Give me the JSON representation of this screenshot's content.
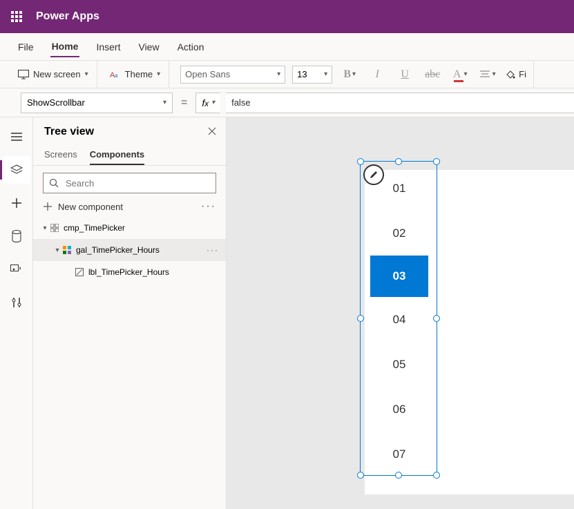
{
  "header": {
    "app_name": "Power Apps"
  },
  "menu": {
    "file": "File",
    "home": "Home",
    "insert": "Insert",
    "view": "View",
    "action": "Action"
  },
  "toolbar": {
    "new_screen": "New screen",
    "theme": "Theme",
    "font": "Open Sans",
    "font_size": "13",
    "format_fill_label": "Fi"
  },
  "formula": {
    "property": "ShowScrollbar",
    "value": "false"
  },
  "tree": {
    "title": "Tree view",
    "tabs": {
      "screens": "Screens",
      "components": "Components"
    },
    "search_placeholder": "Search",
    "new_component": "New component",
    "items": [
      {
        "name": "cmp_TimePicker"
      },
      {
        "name": "gal_TimePicker_Hours"
      },
      {
        "name": "lbl_TimePicker_Hours"
      }
    ]
  },
  "canvas": {
    "hours": [
      "01",
      "02",
      "03",
      "04",
      "05",
      "06",
      "07"
    ],
    "selected_hour": "03"
  }
}
